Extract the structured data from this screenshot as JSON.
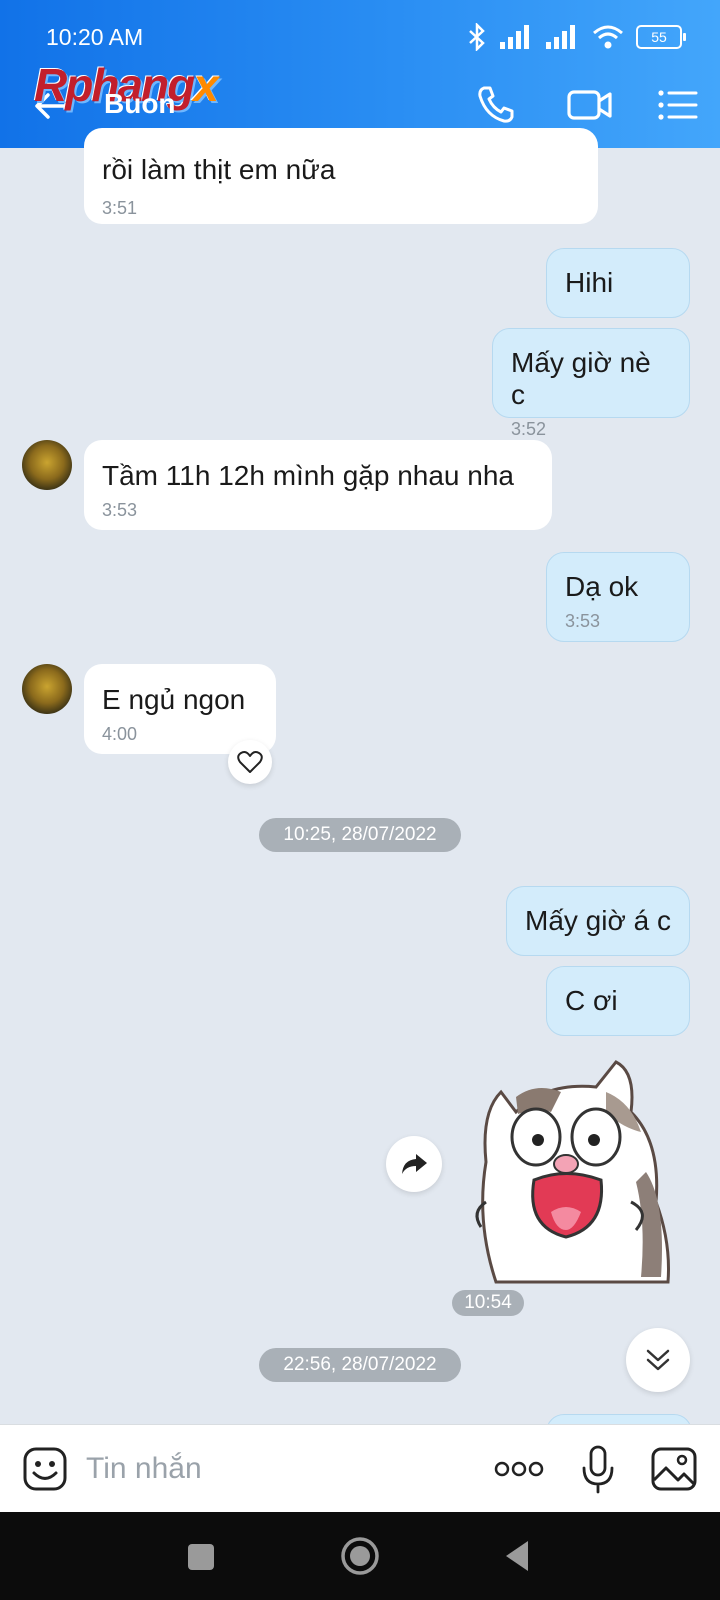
{
  "status": {
    "time": "10:20 AM",
    "battery": "55"
  },
  "header": {
    "watermark_main": "Rphang",
    "watermark_x": "x",
    "contact_name": "Buon"
  },
  "messages": [
    {
      "direction": "in",
      "text": "rồi làm thịt em nữa",
      "time": "3:51"
    },
    {
      "direction": "out",
      "text": "Hihi",
      "time": ""
    },
    {
      "direction": "out",
      "text": "Mấy giờ nè c",
      "time": "3:52"
    },
    {
      "direction": "in",
      "text": "Tầm 11h 12h mình gặp nhau nha",
      "time": "3:53"
    },
    {
      "direction": "out",
      "text": "Dạ ok",
      "time": "3:53"
    },
    {
      "direction": "in",
      "text": "E ngủ ngon",
      "time": "4:00"
    },
    {
      "direction": "out",
      "text": "Mấy giờ á c",
      "time": ""
    },
    {
      "direction": "out",
      "text": "C ơi",
      "time": ""
    }
  ],
  "date_separators": [
    "10:25, 28/07/2022",
    "22:56, 28/07/2022"
  ],
  "sticker": {
    "time": "10:54",
    "icon": "cat-sticker-icon"
  },
  "composer": {
    "placeholder": "Tin nhắn"
  },
  "colors": {
    "header_start": "#1172e8",
    "header_end": "#43a6fb",
    "outgoing_bubble": "#d3ecfb",
    "incoming_bubble": "#ffffff",
    "chat_bg": "#e2e8f0"
  }
}
